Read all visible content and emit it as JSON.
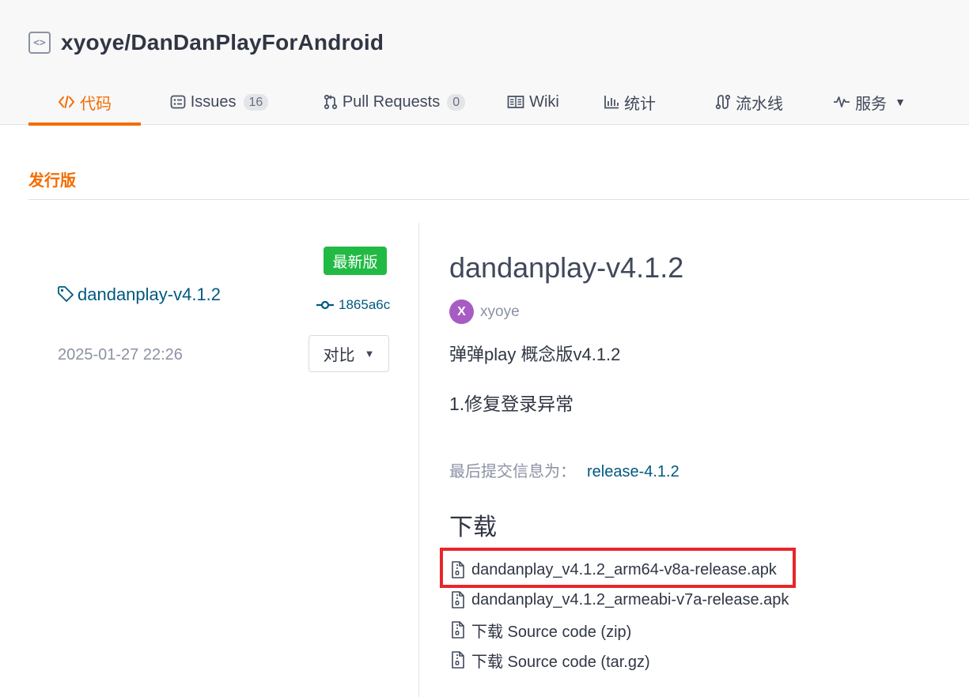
{
  "repo": {
    "name": "xyoye/DanDanPlayForAndroid",
    "icon": "repo-code-icon"
  },
  "tabs": [
    {
      "label": "代码",
      "icon": "code-icon",
      "active": true
    },
    {
      "label": "Issues",
      "icon": "issues-icon",
      "count": "16"
    },
    {
      "label": "Pull Requests",
      "icon": "pull-request-icon",
      "count": "0"
    },
    {
      "label": "Wiki",
      "icon": "book-icon"
    },
    {
      "label": "统计",
      "icon": "bar-chart-icon"
    },
    {
      "label": "流水线",
      "icon": "pipeline-icon"
    },
    {
      "label": "服务",
      "icon": "pulse-icon",
      "dropdown": true
    }
  ],
  "section": {
    "title": "发行版"
  },
  "release": {
    "badge": "最新版",
    "tag": "dandanplay-v4.1.2",
    "commit": "1865a6c",
    "date": "2025-01-27 22:26",
    "compare_label": "对比",
    "title": "dandanplay-v4.1.2",
    "author_initial": "X",
    "author": "xyoye",
    "description_line1": "弹弹play 概念版v4.1.2",
    "description_line2": "1.修复登录异常",
    "commit_info_label": "最后提交信息为：",
    "commit_info_link": "release-4.1.2"
  },
  "downloads": {
    "title": "下载",
    "items": [
      {
        "label": "dandanplay_v4.1.2_arm64-v8a-release.apk",
        "highlighted": true
      },
      {
        "label": "dandanplay_v4.1.2_armeabi-v7a-release.apk"
      },
      {
        "label": "下载 Source code (zip)"
      },
      {
        "label": "下载 Source code (tar.gz)"
      }
    ]
  },
  "colors": {
    "accent": "#f56c00",
    "link": "#005980",
    "badge": "#21ba45",
    "highlight": "#e8262b",
    "avatar": "#a75cc4"
  }
}
